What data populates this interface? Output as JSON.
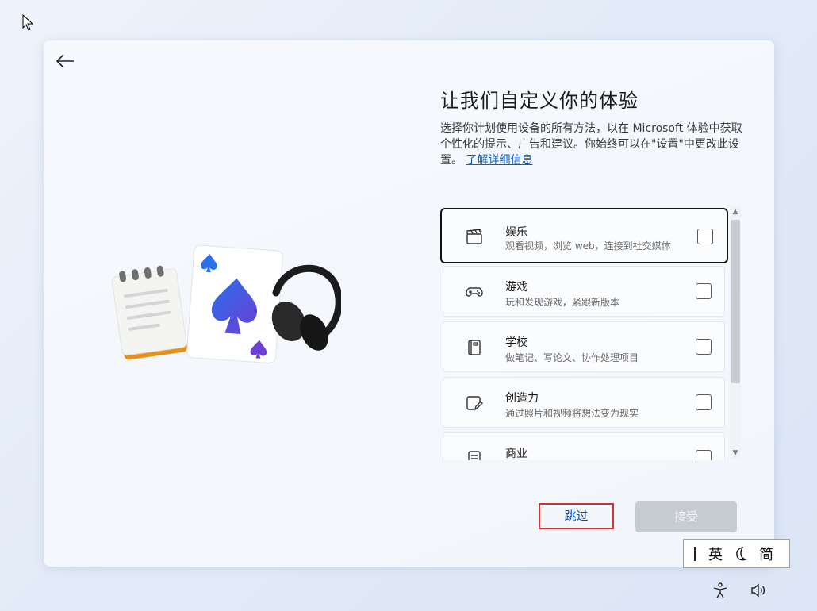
{
  "page": {
    "title": "让我们自定义你的体验",
    "description": "选择你计划使用设备的所有方法，以在 Microsoft 体验中获取个性化的提示、广告和建议。你始终可以在\"设置\"中更改此设置。",
    "learn_more": "了解详细信息"
  },
  "options": [
    {
      "label": "娱乐",
      "sub": "观看视频，浏览 web，连接到社交媒体",
      "icon": "clapperboard-icon"
    },
    {
      "label": "游戏",
      "sub": "玩和发现游戏，紧跟新版本",
      "icon": "gamepad-icon"
    },
    {
      "label": "学校",
      "sub": "做笔记、写论文、协作处理项目",
      "icon": "notebook-icon"
    },
    {
      "label": "创造力",
      "sub": "通过照片和视频将想法变为现实",
      "icon": "note-pen-icon"
    },
    {
      "label": "商业",
      "sub": "",
      "icon": "document-icon"
    }
  ],
  "buttons": {
    "skip": "跳过",
    "accept": "接受"
  },
  "ime": {
    "language": "英",
    "mode": "简"
  },
  "colors": {
    "accent": "#0a5dc2",
    "spade_gradient_start": "#2a66e8",
    "spade_gradient_end": "#6a3fd9",
    "highlight": "#d93030"
  }
}
